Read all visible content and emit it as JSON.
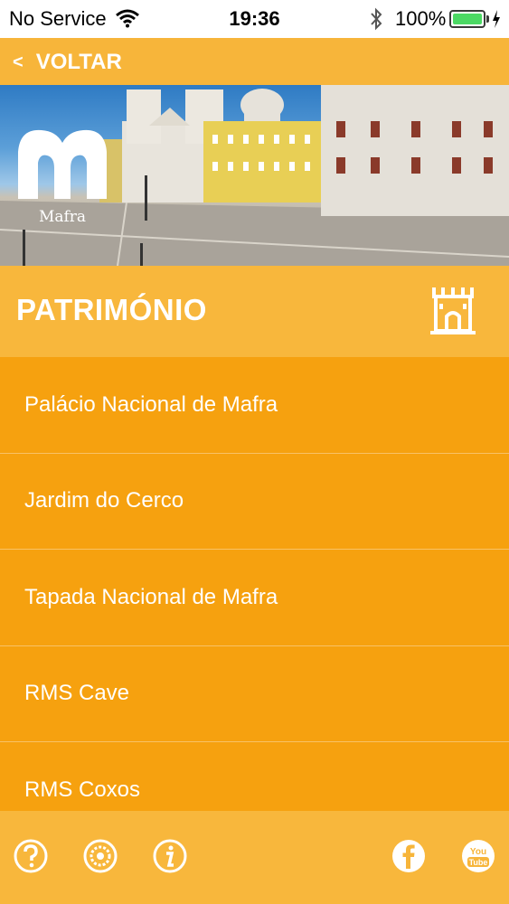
{
  "status_bar": {
    "carrier": "No Service",
    "time": "19:36",
    "battery_percent": "100%",
    "battery_level": 1.0,
    "icons": [
      "wifi-icon",
      "bluetooth-icon",
      "battery-icon",
      "charging-icon"
    ]
  },
  "nav": {
    "back_label": "VOLTAR",
    "back_icon": "chevron-left-icon"
  },
  "hero": {
    "logo_text": "Mafra"
  },
  "section": {
    "title": "PATRIMÓNIO",
    "icon": "castle-icon"
  },
  "list": {
    "items": [
      {
        "label": "Palácio Nacional de Mafra"
      },
      {
        "label": "Jardim do Cerco"
      },
      {
        "label": "Tapada Nacional de Mafra"
      },
      {
        "label": "RMS Cave"
      },
      {
        "label": "RMS Coxos"
      }
    ]
  },
  "footer": {
    "icons": [
      "help-icon",
      "settings-icon",
      "info-icon",
      "facebook-icon",
      "youtube-icon"
    ],
    "youtube_text_top": "You",
    "youtube_text_bottom": "Tube"
  },
  "colors": {
    "accent": "#f7b53a",
    "list_background": "#f6a10f",
    "text": "#ffffff"
  }
}
